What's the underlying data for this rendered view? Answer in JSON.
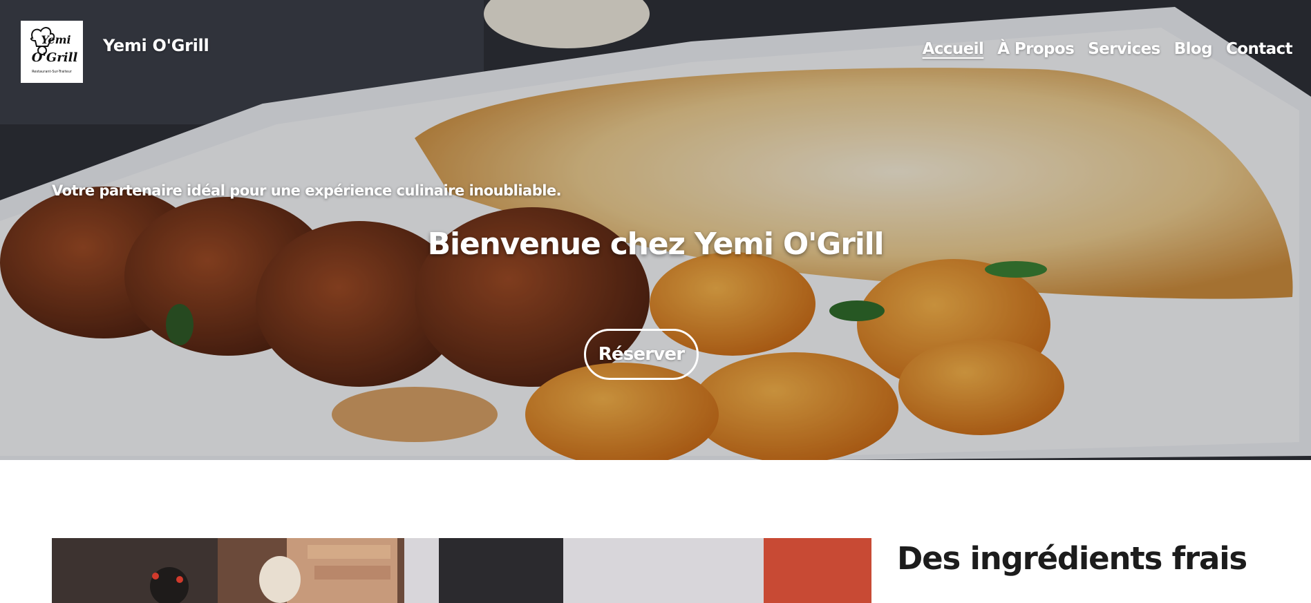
{
  "brand": {
    "logo_text_line1": "Yemi",
    "logo_text_line2": "O'Grill",
    "logo_subtitle": "Restaurant-Sur-Traiteur",
    "site_name": "Yemi O'Grill"
  },
  "nav": {
    "items": [
      {
        "label": "Accueil",
        "active": true
      },
      {
        "label": "À Propos",
        "active": false
      },
      {
        "label": "Services",
        "active": false
      },
      {
        "label": "Blog",
        "active": false
      },
      {
        "label": "Contact",
        "active": false
      }
    ]
  },
  "hero": {
    "tagline": "Votre partenaire idéal pour une expérience culinaire inoubliable.",
    "title": "Bienvenue chez Yemi O'Grill",
    "cta_label": "Réserver"
  },
  "feature": {
    "title": "Des ingrédients frais"
  }
}
